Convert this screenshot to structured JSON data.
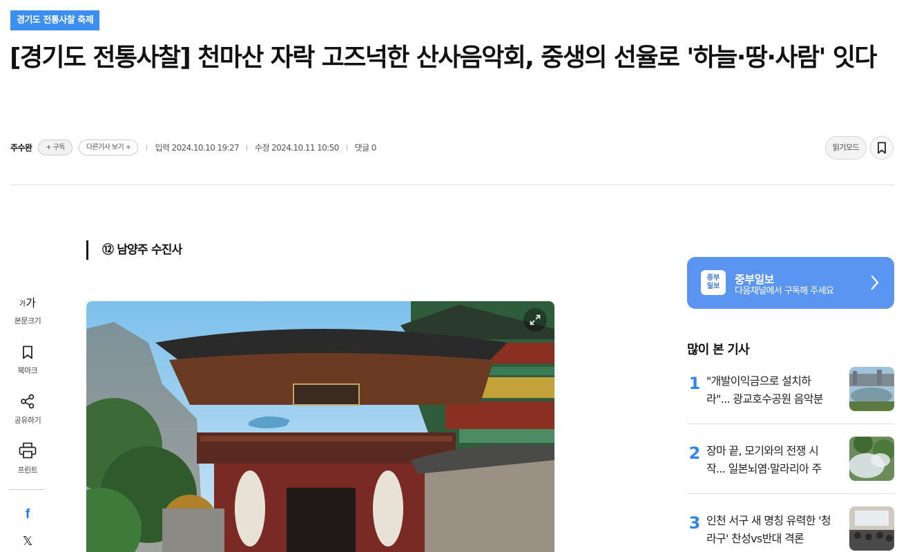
{
  "category": "경기도 전통사찰 축제",
  "headline": "[경기도 전통사찰] 천마산 자락 고즈넉한 산사음악회, 중생의 선율로 '하늘·땅·사람' 잇다",
  "meta": {
    "author": "주수완",
    "subscribe": "+ 구독",
    "other_articles": "다른기사 보기 +",
    "published": "입력 2024.10.10 19:27",
    "modified": "수정 2024.10.11 10:50",
    "comments": "댓글 0"
  },
  "actions": {
    "read_mode": "읽기모드"
  },
  "subhead": "⑫ 남양주 수진사",
  "side_tools": {
    "font_size_glyph_small": "가",
    "font_size_glyph_large": "가",
    "font_size": "본문크기",
    "bookmark": "북마크",
    "share": "공유하기",
    "print": "프린트"
  },
  "social": {
    "facebook": "f",
    "x": "𝕏"
  },
  "subscribe_banner": {
    "logo": "중부\n일보",
    "title": "중부일보",
    "desc": "다음채널에서 구독해 주세요"
  },
  "popular": {
    "title": "많이 본 기사",
    "items": [
      {
        "rank": "1",
        "text": "\"개발이익금으로 설치하라\"... 광교호수공원 음악분"
      },
      {
        "rank": "2",
        "text": "장마 끝, 모기와의 전쟁 시작... 일본뇌염·말라리아 주"
      },
      {
        "rank": "3",
        "text": "인천 서구 새 명칭 유력한 '청라구' 찬성vs반대 격론"
      }
    ]
  },
  "colors": {
    "accent": "#3c8ff0",
    "banner": "#5b95f2",
    "rank": "#2f86ea"
  }
}
